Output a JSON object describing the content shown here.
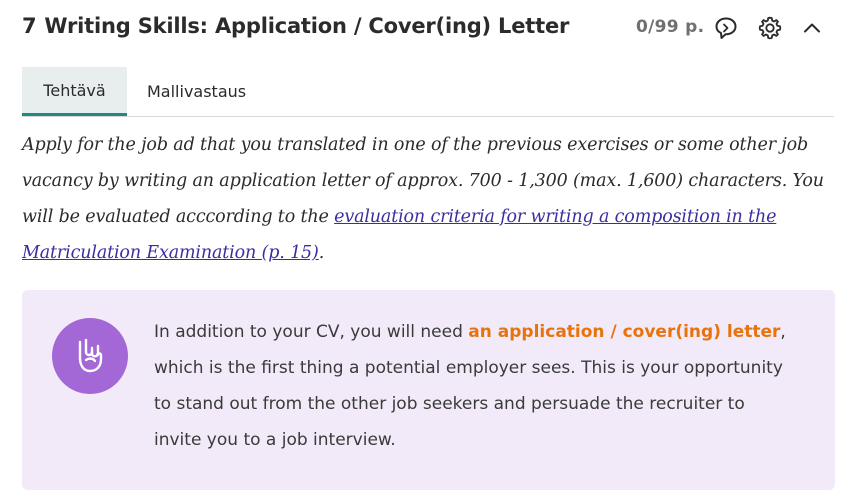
{
  "header": {
    "number": "7",
    "title": "Writing Skills: Application / Cover(ing) Letter",
    "points": "0/99 p.",
    "icons": [
      "chat-bubble-icon",
      "gear-icon",
      "chevron-up-icon"
    ]
  },
  "tabs": [
    {
      "label": "Tehtävä",
      "active": true
    },
    {
      "label": "Mallivastaus",
      "active": false
    }
  ],
  "instruction": {
    "text_before": "Apply for the job ad that you translated in one of the previous exercises or some other job vacancy by writing an application letter of approx. 700 - 1,300 (max. 1,600) characters. You will be evaluated acccording to the ",
    "link_text": "evaluation criteria for writing a composition in the Matriculation Examination (p. 15)",
    "text_after": "."
  },
  "tip": {
    "icon": "rock-hand-icon",
    "text_before": " In addition to your CV, you will need ",
    "highlight": "an application / cover(ing) letter",
    "text_after": ", which is the first thing a potential employer sees. This is your opportunity to stand out from the other job seekers and persuade the recruiter to invite you to a job interview."
  },
  "colors": {
    "accent_teal": "#1f8a83",
    "link": "#3b2fa0",
    "tip_background": "#f2eaf8",
    "tip_icon": "#a467d6",
    "highlight_orange": "#e8730c"
  }
}
